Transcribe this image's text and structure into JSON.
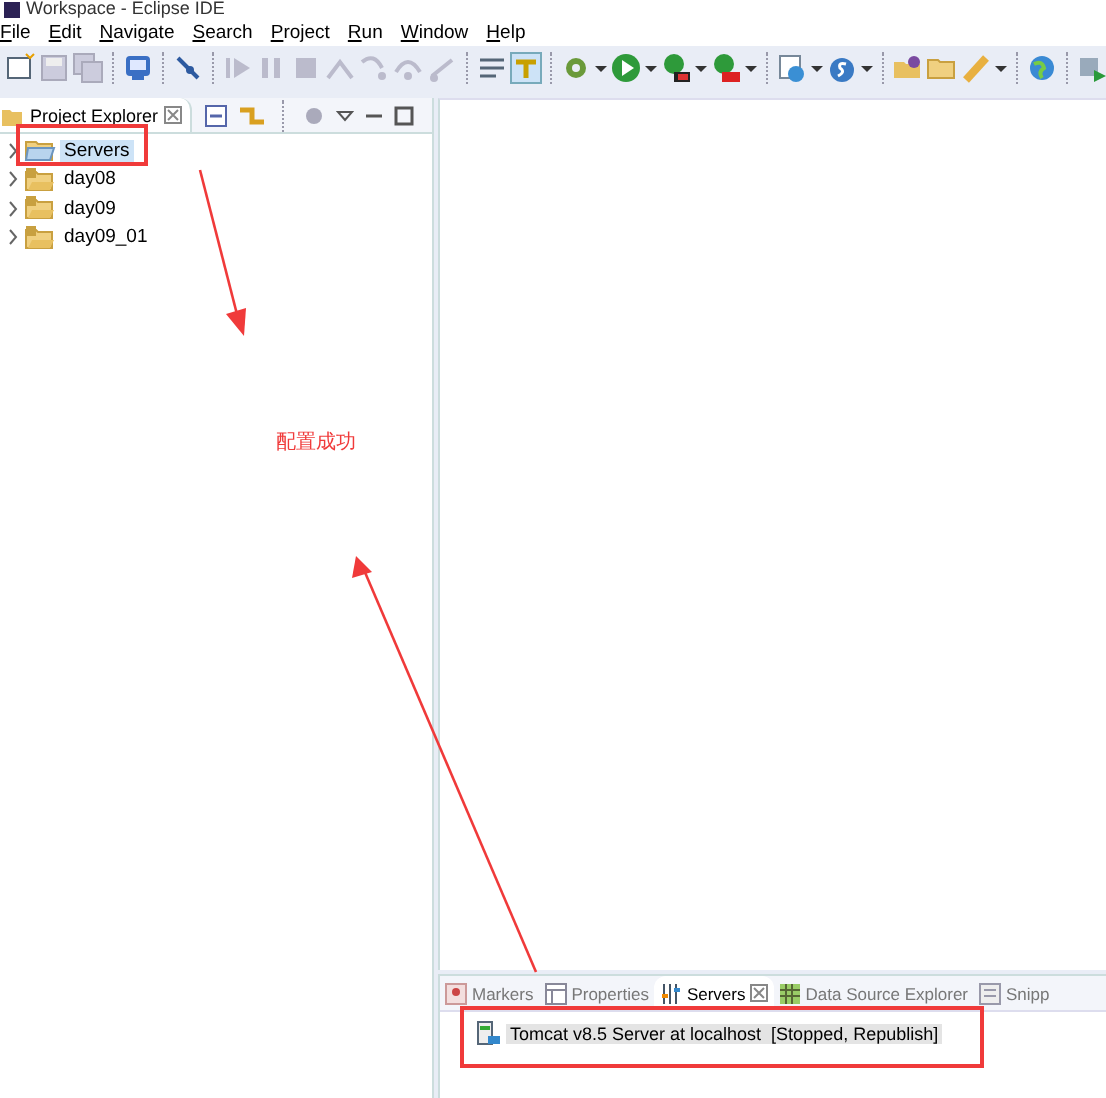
{
  "window": {
    "title": "Workspace - Eclipse IDE"
  },
  "menu": [
    "File",
    "Edit",
    "Navigate",
    "Search",
    "Project",
    "Run",
    "Window",
    "Help"
  ],
  "explorer": {
    "tab": "Project Explorer",
    "items": [
      {
        "label": "Servers",
        "kind": "folder",
        "selected": true,
        "expanded": false
      },
      {
        "label": "day08",
        "kind": "project",
        "selected": false,
        "expanded": false
      },
      {
        "label": "day09",
        "kind": "project",
        "selected": false,
        "expanded": false
      },
      {
        "label": "day09_01",
        "kind": "project",
        "selected": false,
        "expanded": false
      }
    ]
  },
  "bottom_panel": {
    "tabs": [
      {
        "label": "Markers",
        "selected": false
      },
      {
        "label": "Properties",
        "selected": false
      },
      {
        "label": "Servers",
        "selected": true
      },
      {
        "label": "Data Source Explorer",
        "selected": false
      },
      {
        "label": "Snipp",
        "selected": false
      }
    ],
    "servers": [
      {
        "name": "Tomcat v8.5 Server at localhost",
        "status": "[Stopped, Republish]",
        "selected": true
      }
    ]
  },
  "annotation": {
    "text": "配置成功"
  }
}
